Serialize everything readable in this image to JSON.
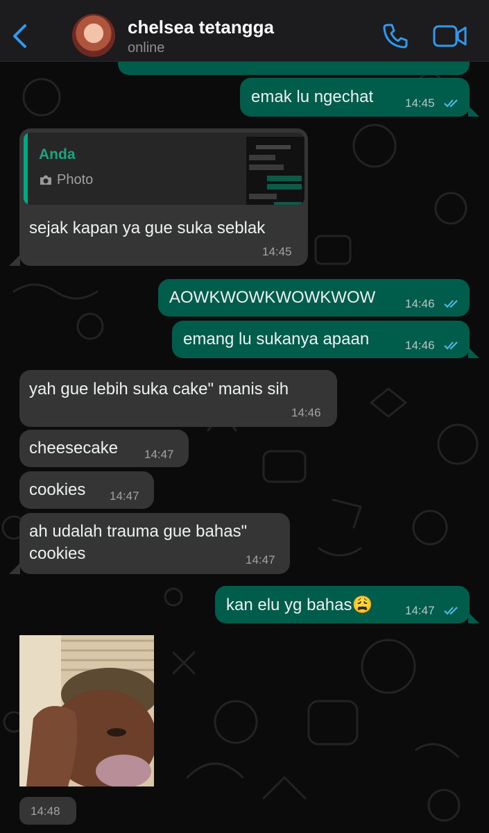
{
  "header": {
    "contact_name": "chelsea tetangga",
    "status": "online",
    "back_icon": "chevron-left-icon",
    "call_icon": "phone-icon",
    "video_icon": "video-camera-icon",
    "accent_color": "#2f9bf0"
  },
  "colors": {
    "outgoing_bubble": "#005c4b",
    "incoming_bubble": "#353535",
    "read_ticks": "#53bdeb",
    "quote_bar": "#00a884"
  },
  "messages": [
    {
      "direction": "out",
      "text": "emak lu ngechat",
      "time": "14:45",
      "read": true
    },
    {
      "direction": "in",
      "quote": {
        "author": "Anda",
        "type_label": "Photo",
        "icon": "camera-icon"
      },
      "text": "sejak kapan ya gue suka seblak",
      "time": "14:45"
    },
    {
      "direction": "out",
      "text": "AOWKWOWKWOWKWOW",
      "time": "14:46",
      "read": true
    },
    {
      "direction": "out",
      "text": "emang lu sukanya apaan",
      "time": "14:46",
      "read": true
    },
    {
      "direction": "in",
      "text": "yah gue lebih suka cake\" manis sih",
      "time": "14:46"
    },
    {
      "direction": "in",
      "text": "cheesecake",
      "time": "14:47"
    },
    {
      "direction": "in",
      "text": "cookies",
      "time": "14:47"
    },
    {
      "direction": "in",
      "lines": [
        "ah udalah trauma gue bahas\"",
        "cookies"
      ],
      "time": "14:47"
    },
    {
      "direction": "out",
      "text": "kan elu yg bahas😩",
      "time": "14:47",
      "read": true
    },
    {
      "direction": "in",
      "type": "image",
      "image_label": "photo of crying person",
      "time": "14:48"
    }
  ]
}
